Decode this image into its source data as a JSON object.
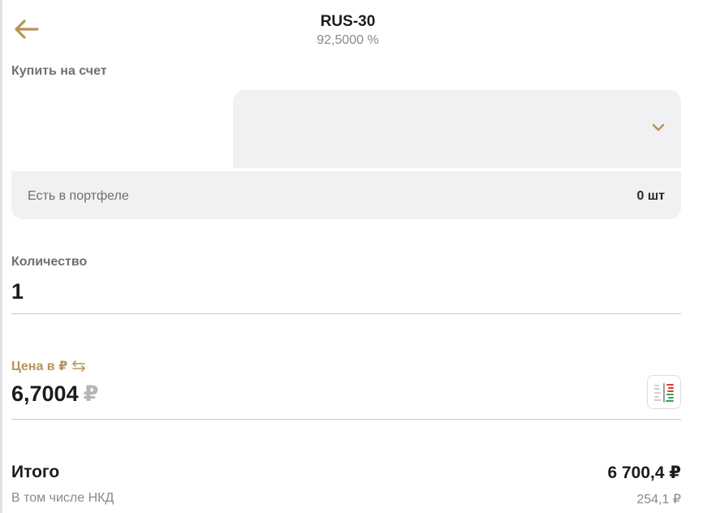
{
  "header": {
    "title": "RUS-30",
    "subtitle": "92,5000 %"
  },
  "account": {
    "label": "Купить на счет",
    "selected_value": ""
  },
  "portfolio": {
    "label": "Есть в портфеле",
    "value": "0 шт"
  },
  "quantity": {
    "label": "Количество",
    "value": "1"
  },
  "price": {
    "label": "Цена в ₽",
    "value": "6,7004",
    "currency": "₽"
  },
  "summary": {
    "total_label": "Итого",
    "total_value": "6 700,4 ₽",
    "nkd_label": "В том числе НКД",
    "nkd_value": "254,1 ₽"
  },
  "icons": {
    "back": "arrow-left-icon",
    "dropdown": "chevron-down-icon",
    "swap": "swap-arrows-icon",
    "orderbook": "order-book-icon"
  },
  "colors": {
    "accent": "#b7945a",
    "field_bg": "#f1f1f3",
    "ask": "#e53935",
    "bid": "#2eaa4f"
  }
}
